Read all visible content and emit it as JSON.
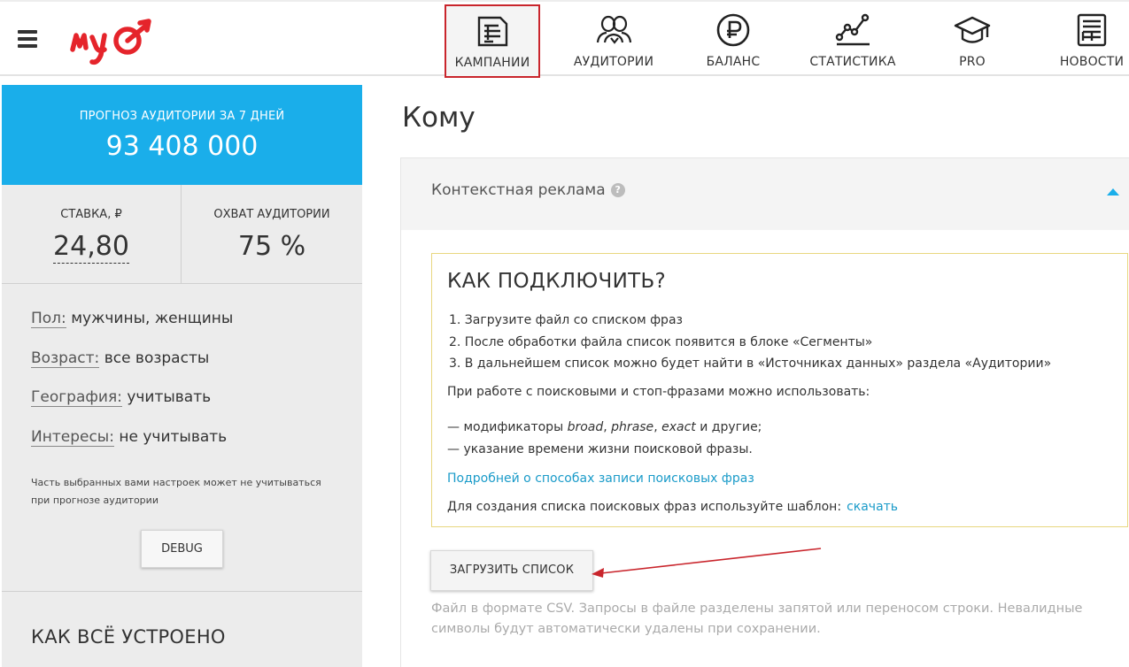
{
  "header": {
    "nav": [
      {
        "label": "КАМПАНИИ",
        "icon": "campaigns-icon",
        "active": true
      },
      {
        "label": "АУДИТОРИИ",
        "icon": "audiences-icon",
        "active": false
      },
      {
        "label": "БАЛАНС",
        "icon": "ruble-icon",
        "active": false
      },
      {
        "label": "СТАТИСТИКА",
        "icon": "statistics-icon",
        "active": false
      },
      {
        "label": "PRO",
        "icon": "graduation-cap-icon",
        "active": false
      },
      {
        "label": "НОВОСТИ",
        "icon": "news-icon",
        "active": false
      }
    ],
    "accent_color": "#c9252c"
  },
  "sidebar": {
    "forecast_title": "ПРОГНОЗ АУДИТОРИИ ЗА 7 ДНЕЙ",
    "forecast_value": "93 408 000",
    "rate_title": "СТАВКА, ₽",
    "rate_value": "24,80",
    "reach_title": "ОХВАТ АУДИТОРИИ",
    "reach_value": "75 %",
    "params": [
      {
        "key": "Пол:",
        "value": "мужчины, женщины"
      },
      {
        "key": "Возраст:",
        "value": "все возрасты"
      },
      {
        "key": "География:",
        "value": "учитывать"
      },
      {
        "key": "Интересы:",
        "value": "не учитывать"
      }
    ],
    "note": "Часть выбранных вами настроек может не учитываться при прогнозе аудитории",
    "debug_label": "DEBUG",
    "how_title": "КАК ВСЁ УСТРОЕНО",
    "forecast_color": "#1aaeea"
  },
  "main": {
    "title": "Кому",
    "section_title": "Контекстная реклама",
    "help_mark": "?",
    "howto": {
      "title": "КАК ПОДКЛЮЧИТЬ?",
      "steps": [
        "1. Загрузите файл со списком фраз",
        "2. После обработки файла список появится в блоке «Сегменты»",
        "3. В дальнейшем список можно будет найти в «Источниках данных» раздела «Аудитории»"
      ],
      "intro": "При работе с поисковыми и стоп-фразами можно использовать:",
      "bullet1_pre": "—  модификаторы ",
      "bullet1_m1": "broad",
      "bullet1_sep1": ", ",
      "bullet1_m2": "phrase",
      "bullet1_sep2": ", ",
      "bullet1_m3": "exact",
      "bullet1_post": " и другие;",
      "bullet2": "—  указание времени жизни поисковой фразы.",
      "more_link": "Подробней о способах записи поисковых фраз",
      "template_text": "Для создания списка поисковых фраз используйте шаблон:",
      "download_link": "скачать"
    },
    "upload_label": "ЗАГРУЗИТЬ СПИСОК",
    "hint": "Файл в формате CSV. Запросы в файле разделены запятой или переносом строки. Невалидные символы будут автоматически удалены при сохранении."
  }
}
